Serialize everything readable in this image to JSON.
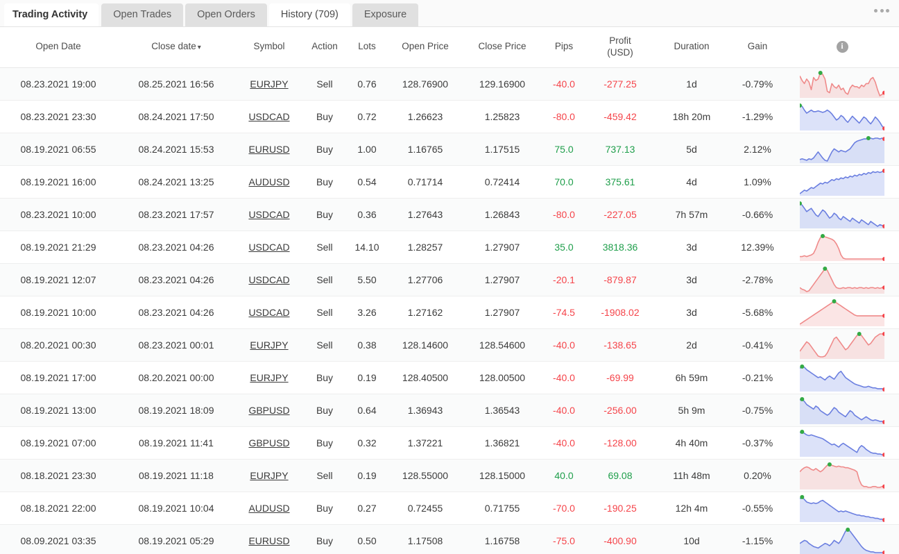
{
  "tabs": [
    {
      "label": "Trading Activity",
      "style": "first"
    },
    {
      "label": "Open Trades",
      "style": "grey"
    },
    {
      "label": "Open Orders",
      "style": "grey"
    },
    {
      "label": "History (709)",
      "style": "white"
    },
    {
      "label": "Exposure",
      "style": "grey"
    }
  ],
  "overflow_menu": "more-options",
  "colors": {
    "positive": "#1e9e4a",
    "negative": "#f5444a",
    "text": "#3b3b3b",
    "buy_chart": "#6b7fe0",
    "sell_chart": "#ef8a8a",
    "tab_active_bg": "#ffffff",
    "tab_inactive_bg": "#e0e0e0"
  },
  "table": {
    "columns": [
      {
        "label": "Open Date",
        "key": "open_date",
        "sorted": false
      },
      {
        "label": "Close date",
        "key": "close_date",
        "sorted": true,
        "sort_dir": "desc",
        "caret": "▾"
      },
      {
        "label": "Symbol",
        "key": "symbol",
        "sorted": false
      },
      {
        "label": "Action",
        "key": "action",
        "sorted": false
      },
      {
        "label": "Lots",
        "key": "lots",
        "sorted": false
      },
      {
        "label": "Open Price",
        "key": "open_price",
        "sorted": false
      },
      {
        "label": "Close Price",
        "key": "close_price",
        "sorted": false
      },
      {
        "label": "Pips",
        "key": "pips",
        "sorted": false
      },
      {
        "label": "Profit (USD)",
        "label_line1": "Profit",
        "label_line2": "(USD)",
        "key": "profit",
        "sorted": false
      },
      {
        "label": "Duration",
        "key": "duration",
        "sorted": false
      },
      {
        "label": "Gain",
        "key": "gain",
        "sorted": false
      },
      {
        "label": "",
        "key": "chart",
        "icon": "info-icon",
        "sorted": false
      }
    ],
    "rows": [
      {
        "open_date": "08.23.2021 19:00",
        "close_date": "08.25.2021 16:56",
        "symbol": "EURJPY",
        "action": "Sell",
        "lots": "0.76",
        "open_price": "128.76900",
        "close_price": "129.16900",
        "pips": "-40.0",
        "pips_sign": "neg",
        "profit": "-277.25",
        "profit_sign": "neg",
        "duration": "1d",
        "gain": "-0.79%",
        "chart_color": "sell",
        "chart_points": [
          28,
          22,
          18,
          24,
          20,
          10,
          26,
          22,
          24,
          32,
          30,
          24,
          8,
          6,
          18,
          14,
          12,
          16,
          10,
          12,
          6,
          4,
          12,
          16,
          14,
          14,
          12,
          16,
          14,
          18,
          18,
          24,
          26,
          20,
          10,
          2,
          4,
          6
        ]
      },
      {
        "open_date": "08.23.2021 23:30",
        "close_date": "08.24.2021 17:50",
        "symbol": "USDCAD",
        "action": "Buy",
        "lots": "0.72",
        "open_price": "1.26623",
        "close_price": "1.25823",
        "pips": "-80.0",
        "pips_sign": "neg",
        "profit": "-459.42",
        "profit_sign": "neg",
        "duration": "18h 20m",
        "gain": "-1.29%",
        "chart_color": "buy",
        "chart_points": [
          32,
          31,
          26,
          22,
          24,
          26,
          24,
          24,
          25,
          24,
          23,
          24,
          26,
          24,
          21,
          17,
          13,
          15,
          19,
          17,
          13,
          10,
          14,
          18,
          15,
          12,
          9,
          13,
          17,
          15,
          11,
          8,
          12,
          17,
          14,
          10,
          5,
          2
        ]
      },
      {
        "open_date": "08.19.2021 06:55",
        "close_date": "08.24.2021 15:53",
        "symbol": "EURUSD",
        "action": "Buy",
        "lots": "1.00",
        "open_price": "1.16765",
        "close_price": "1.17515",
        "pips": "75.0",
        "pips_sign": "pos",
        "profit": "737.13",
        "profit_sign": "pos",
        "duration": "5d",
        "gain": "2.12%",
        "chart_color": "buy",
        "chart_points": [
          4,
          5,
          4,
          3,
          5,
          4,
          6,
          10,
          14,
          10,
          6,
          3,
          2,
          8,
          14,
          18,
          16,
          14,
          16,
          15,
          14,
          16,
          18,
          22,
          26,
          28,
          29,
          30,
          31,
          31,
          32,
          32,
          31,
          32,
          32,
          31,
          32,
          31
        ]
      },
      {
        "open_date": "08.19.2021 16:00",
        "close_date": "08.24.2021 13:25",
        "symbol": "AUDUSD",
        "action": "Buy",
        "lots": "0.54",
        "open_price": "0.71714",
        "close_price": "0.72414",
        "pips": "70.0",
        "pips_sign": "pos",
        "profit": "375.61",
        "profit_sign": "pos",
        "duration": "4d",
        "gain": "1.09%",
        "chart_color": "buy",
        "chart_points": [
          6,
          8,
          10,
          9,
          11,
          13,
          12,
          14,
          16,
          18,
          17,
          19,
          18,
          20,
          22,
          21,
          23,
          22,
          24,
          23,
          25,
          24,
          26,
          25,
          27,
          26,
          28,
          27,
          29,
          28,
          30,
          29,
          31,
          30,
          31,
          30,
          31,
          32
        ]
      },
      {
        "open_date": "08.23.2021 10:00",
        "close_date": "08.23.2021 17:57",
        "symbol": "USDCAD",
        "action": "Buy",
        "lots": "0.36",
        "open_price": "1.27643",
        "close_price": "1.26843",
        "pips": "-80.0",
        "pips_sign": "neg",
        "profit": "-227.05",
        "profit_sign": "neg",
        "duration": "7h 57m",
        "gain": "-0.66%",
        "chart_color": "buy",
        "chart_points": [
          30,
          28,
          24,
          20,
          22,
          24,
          20,
          16,
          14,
          18,
          22,
          20,
          16,
          12,
          14,
          18,
          16,
          12,
          10,
          14,
          12,
          10,
          8,
          12,
          10,
          8,
          6,
          10,
          8,
          6,
          4,
          8,
          6,
          4,
          2,
          4,
          3,
          2
        ]
      },
      {
        "open_date": "08.19.2021 21:29",
        "close_date": "08.23.2021 04:26",
        "symbol": "USDCAD",
        "action": "Sell",
        "lots": "14.10",
        "open_price": "1.28257",
        "close_price": "1.27907",
        "pips": "35.0",
        "pips_sign": "pos",
        "profit": "3818.36",
        "profit_sign": "pos",
        "duration": "3d",
        "gain": "12.39%",
        "chart_color": "sell",
        "chart_points": [
          6,
          6,
          7,
          6,
          7,
          8,
          10,
          16,
          24,
          30,
          32,
          31,
          30,
          29,
          28,
          26,
          22,
          16,
          8,
          4,
          3,
          3,
          3,
          3,
          3,
          3,
          3,
          3,
          3,
          3,
          3,
          3,
          3,
          3,
          3,
          3,
          3,
          3
        ]
      },
      {
        "open_date": "08.19.2021 12:07",
        "close_date": "08.23.2021 04:26",
        "symbol": "USDCAD",
        "action": "Sell",
        "lots": "5.50",
        "open_price": "1.27706",
        "close_price": "1.27907",
        "pips": "-20.1",
        "pips_sign": "neg",
        "profit": "-879.87",
        "profit_sign": "neg",
        "duration": "3d",
        "gain": "-2.78%",
        "chart_color": "sell",
        "chart_points": [
          8,
          6,
          5,
          3,
          4,
          8,
          12,
          16,
          20,
          24,
          28,
          32,
          30,
          24,
          18,
          12,
          8,
          7,
          7,
          8,
          7,
          8,
          8,
          7,
          8,
          7,
          8,
          8,
          7,
          8,
          7,
          8,
          8,
          7,
          8,
          7,
          8,
          8
        ]
      },
      {
        "open_date": "08.19.2021 10:00",
        "close_date": "08.23.2021 04:26",
        "symbol": "USDCAD",
        "action": "Sell",
        "lots": "3.26",
        "open_price": "1.27162",
        "close_price": "1.27907",
        "pips": "-74.5",
        "pips_sign": "neg",
        "profit": "-1908.02",
        "profit_sign": "neg",
        "duration": "3d",
        "gain": "-5.68%",
        "chart_color": "sell",
        "chart_points": [
          2,
          4,
          6,
          8,
          10,
          12,
          14,
          16,
          18,
          20,
          22,
          24,
          26,
          28,
          30,
          32,
          30,
          28,
          26,
          24,
          22,
          20,
          18,
          16,
          14,
          13,
          13,
          13,
          13,
          13,
          13,
          13,
          13,
          13,
          13,
          13,
          13,
          13
        ]
      },
      {
        "open_date": "08.20.2021 00:30",
        "close_date": "08.23.2021 00:01",
        "symbol": "EURJPY",
        "action": "Sell",
        "lots": "0.38",
        "open_price": "128.14600",
        "close_price": "128.54600",
        "pips": "-40.0",
        "pips_sign": "neg",
        "profit": "-138.65",
        "profit_sign": "neg",
        "duration": "2d",
        "gain": "-0.41%",
        "chart_color": "sell",
        "chart_points": [
          10,
          14,
          18,
          22,
          20,
          16,
          12,
          8,
          4,
          3,
          3,
          4,
          8,
          14,
          20,
          26,
          28,
          24,
          20,
          16,
          12,
          14,
          18,
          22,
          26,
          30,
          32,
          30,
          26,
          22,
          18,
          20,
          24,
          28,
          30,
          32,
          32,
          32
        ]
      },
      {
        "open_date": "08.19.2021 17:00",
        "close_date": "08.20.2021 00:00",
        "symbol": "EURJPY",
        "action": "Buy",
        "lots": "0.19",
        "open_price": "128.40500",
        "close_price": "128.00500",
        "pips": "-40.0",
        "pips_sign": "neg",
        "profit": "-69.99",
        "profit_sign": "neg",
        "duration": "6h 59m",
        "gain": "-0.21%",
        "chart_color": "buy",
        "chart_points": [
          28,
          30,
          29,
          26,
          24,
          22,
          20,
          18,
          16,
          17,
          15,
          13,
          16,
          18,
          16,
          14,
          18,
          22,
          24,
          20,
          16,
          14,
          12,
          10,
          8,
          7,
          6,
          5,
          4,
          4,
          5,
          4,
          3,
          3,
          2,
          2,
          2,
          1
        ]
      },
      {
        "open_date": "08.19.2021 13:00",
        "close_date": "08.19.2021 18:09",
        "symbol": "GBPUSD",
        "action": "Buy",
        "lots": "0.64",
        "open_price": "1.36943",
        "close_price": "1.36543",
        "pips": "-40.0",
        "pips_sign": "neg",
        "profit": "-256.00",
        "profit_sign": "neg",
        "duration": "5h 9m",
        "gain": "-0.75%",
        "chart_color": "buy",
        "chart_points": [
          30,
          31,
          28,
          24,
          22,
          20,
          18,
          22,
          20,
          16,
          14,
          12,
          10,
          12,
          16,
          20,
          18,
          14,
          12,
          10,
          8,
          12,
          16,
          14,
          10,
          8,
          6,
          4,
          6,
          8,
          6,
          4,
          3,
          4,
          3,
          2,
          2,
          1
        ]
      },
      {
        "open_date": "08.19.2021 07:00",
        "close_date": "08.19.2021 11:41",
        "symbol": "GBPUSD",
        "action": "Buy",
        "lots": "0.32",
        "open_price": "1.37221",
        "close_price": "1.36821",
        "pips": "-40.0",
        "pips_sign": "neg",
        "profit": "-128.00",
        "profit_sign": "neg",
        "duration": "4h 40m",
        "gain": "-0.37%",
        "chart_color": "buy",
        "chart_points": [
          30,
          31,
          29,
          27,
          26,
          27,
          26,
          25,
          24,
          23,
          22,
          20,
          18,
          16,
          14,
          15,
          13,
          11,
          14,
          16,
          14,
          12,
          10,
          8,
          6,
          4,
          10,
          13,
          11,
          8,
          6,
          4,
          3,
          3,
          2,
          2,
          1,
          1
        ]
      },
      {
        "open_date": "08.18.2021 23:30",
        "close_date": "08.19.2021 11:18",
        "symbol": "EURJPY",
        "action": "Sell",
        "lots": "0.19",
        "open_price": "128.55000",
        "close_price": "128.15000",
        "pips": "40.0",
        "pips_sign": "pos",
        "profit": "69.08",
        "profit_sign": "pos",
        "duration": "11h 48m",
        "gain": "0.20%",
        "chart_color": "sell",
        "chart_points": [
          22,
          25,
          27,
          28,
          27,
          25,
          24,
          26,
          24,
          22,
          24,
          27,
          30,
          31,
          30,
          29,
          28,
          29,
          28,
          28,
          27,
          27,
          26,
          25,
          24,
          22,
          12,
          6,
          4,
          4,
          3,
          3,
          4,
          4,
          3,
          3,
          4,
          4
        ]
      },
      {
        "open_date": "08.18.2021 22:00",
        "close_date": "08.19.2021 10:04",
        "symbol": "AUDUSD",
        "action": "Buy",
        "lots": "0.27",
        "open_price": "0.72455",
        "close_price": "0.71755",
        "pips": "-70.0",
        "pips_sign": "neg",
        "profit": "-190.25",
        "profit_sign": "neg",
        "duration": "12h 4m",
        "gain": "-0.55%",
        "chart_color": "buy",
        "chart_points": [
          28,
          30,
          27,
          24,
          23,
          22,
          23,
          22,
          23,
          25,
          26,
          24,
          22,
          20,
          18,
          16,
          14,
          12,
          13,
          12,
          13,
          12,
          11,
          10,
          9,
          8,
          8,
          7,
          7,
          6,
          6,
          5,
          5,
          4,
          4,
          3,
          3,
          2
        ]
      },
      {
        "open_date": "08.09.2021 03:35",
        "close_date": "08.19.2021 05:29",
        "symbol": "EURUSD",
        "action": "Buy",
        "lots": "0.50",
        "open_price": "1.17508",
        "close_price": "1.16758",
        "pips": "-75.0",
        "pips_sign": "neg",
        "profit": "-400.90",
        "profit_sign": "neg",
        "duration": "10d",
        "gain": "-1.15%",
        "chart_color": "buy",
        "chart_points": [
          14,
          16,
          18,
          17,
          14,
          12,
          10,
          9,
          8,
          10,
          12,
          14,
          13,
          11,
          14,
          18,
          16,
          14,
          18,
          24,
          30,
          32,
          30,
          26,
          22,
          18,
          14,
          10,
          7,
          5,
          4,
          3,
          3,
          2,
          2,
          2,
          2,
          2
        ]
      }
    ]
  }
}
